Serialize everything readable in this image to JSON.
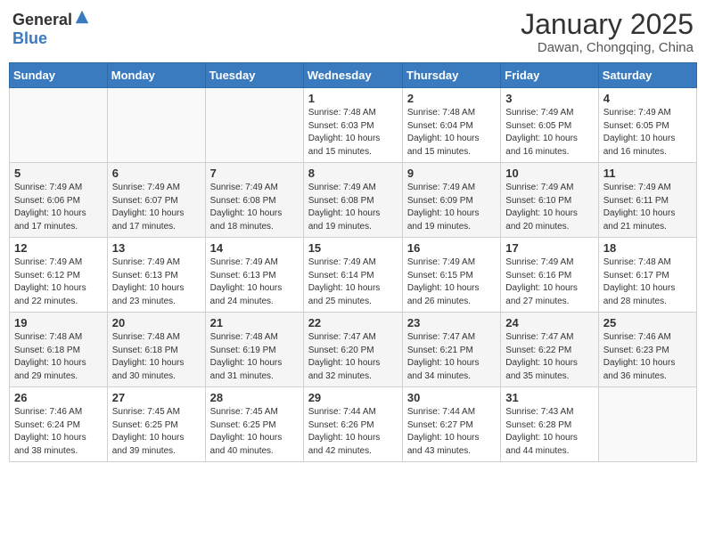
{
  "header": {
    "logo_general": "General",
    "logo_blue": "Blue",
    "month_year": "January 2025",
    "location": "Dawan, Chongqing, China"
  },
  "weekdays": [
    "Sunday",
    "Monday",
    "Tuesday",
    "Wednesday",
    "Thursday",
    "Friday",
    "Saturday"
  ],
  "weeks": [
    [
      {
        "day": "",
        "info": ""
      },
      {
        "day": "",
        "info": ""
      },
      {
        "day": "",
        "info": ""
      },
      {
        "day": "1",
        "info": "Sunrise: 7:48 AM\nSunset: 6:03 PM\nDaylight: 10 hours\nand 15 minutes."
      },
      {
        "day": "2",
        "info": "Sunrise: 7:48 AM\nSunset: 6:04 PM\nDaylight: 10 hours\nand 15 minutes."
      },
      {
        "day": "3",
        "info": "Sunrise: 7:49 AM\nSunset: 6:05 PM\nDaylight: 10 hours\nand 16 minutes."
      },
      {
        "day": "4",
        "info": "Sunrise: 7:49 AM\nSunset: 6:05 PM\nDaylight: 10 hours\nand 16 minutes."
      }
    ],
    [
      {
        "day": "5",
        "info": "Sunrise: 7:49 AM\nSunset: 6:06 PM\nDaylight: 10 hours\nand 17 minutes."
      },
      {
        "day": "6",
        "info": "Sunrise: 7:49 AM\nSunset: 6:07 PM\nDaylight: 10 hours\nand 17 minutes."
      },
      {
        "day": "7",
        "info": "Sunrise: 7:49 AM\nSunset: 6:08 PM\nDaylight: 10 hours\nand 18 minutes."
      },
      {
        "day": "8",
        "info": "Sunrise: 7:49 AM\nSunset: 6:08 PM\nDaylight: 10 hours\nand 19 minutes."
      },
      {
        "day": "9",
        "info": "Sunrise: 7:49 AM\nSunset: 6:09 PM\nDaylight: 10 hours\nand 19 minutes."
      },
      {
        "day": "10",
        "info": "Sunrise: 7:49 AM\nSunset: 6:10 PM\nDaylight: 10 hours\nand 20 minutes."
      },
      {
        "day": "11",
        "info": "Sunrise: 7:49 AM\nSunset: 6:11 PM\nDaylight: 10 hours\nand 21 minutes."
      }
    ],
    [
      {
        "day": "12",
        "info": "Sunrise: 7:49 AM\nSunset: 6:12 PM\nDaylight: 10 hours\nand 22 minutes."
      },
      {
        "day": "13",
        "info": "Sunrise: 7:49 AM\nSunset: 6:13 PM\nDaylight: 10 hours\nand 23 minutes."
      },
      {
        "day": "14",
        "info": "Sunrise: 7:49 AM\nSunset: 6:13 PM\nDaylight: 10 hours\nand 24 minutes."
      },
      {
        "day": "15",
        "info": "Sunrise: 7:49 AM\nSunset: 6:14 PM\nDaylight: 10 hours\nand 25 minutes."
      },
      {
        "day": "16",
        "info": "Sunrise: 7:49 AM\nSunset: 6:15 PM\nDaylight: 10 hours\nand 26 minutes."
      },
      {
        "day": "17",
        "info": "Sunrise: 7:49 AM\nSunset: 6:16 PM\nDaylight: 10 hours\nand 27 minutes."
      },
      {
        "day": "18",
        "info": "Sunrise: 7:48 AM\nSunset: 6:17 PM\nDaylight: 10 hours\nand 28 minutes."
      }
    ],
    [
      {
        "day": "19",
        "info": "Sunrise: 7:48 AM\nSunset: 6:18 PM\nDaylight: 10 hours\nand 29 minutes."
      },
      {
        "day": "20",
        "info": "Sunrise: 7:48 AM\nSunset: 6:18 PM\nDaylight: 10 hours\nand 30 minutes."
      },
      {
        "day": "21",
        "info": "Sunrise: 7:48 AM\nSunset: 6:19 PM\nDaylight: 10 hours\nand 31 minutes."
      },
      {
        "day": "22",
        "info": "Sunrise: 7:47 AM\nSunset: 6:20 PM\nDaylight: 10 hours\nand 32 minutes."
      },
      {
        "day": "23",
        "info": "Sunrise: 7:47 AM\nSunset: 6:21 PM\nDaylight: 10 hours\nand 34 minutes."
      },
      {
        "day": "24",
        "info": "Sunrise: 7:47 AM\nSunset: 6:22 PM\nDaylight: 10 hours\nand 35 minutes."
      },
      {
        "day": "25",
        "info": "Sunrise: 7:46 AM\nSunset: 6:23 PM\nDaylight: 10 hours\nand 36 minutes."
      }
    ],
    [
      {
        "day": "26",
        "info": "Sunrise: 7:46 AM\nSunset: 6:24 PM\nDaylight: 10 hours\nand 38 minutes."
      },
      {
        "day": "27",
        "info": "Sunrise: 7:45 AM\nSunset: 6:25 PM\nDaylight: 10 hours\nand 39 minutes."
      },
      {
        "day": "28",
        "info": "Sunrise: 7:45 AM\nSunset: 6:25 PM\nDaylight: 10 hours\nand 40 minutes."
      },
      {
        "day": "29",
        "info": "Sunrise: 7:44 AM\nSunset: 6:26 PM\nDaylight: 10 hours\nand 42 minutes."
      },
      {
        "day": "30",
        "info": "Sunrise: 7:44 AM\nSunset: 6:27 PM\nDaylight: 10 hours\nand 43 minutes."
      },
      {
        "day": "31",
        "info": "Sunrise: 7:43 AM\nSunset: 6:28 PM\nDaylight: 10 hours\nand 44 minutes."
      },
      {
        "day": "",
        "info": ""
      }
    ]
  ]
}
